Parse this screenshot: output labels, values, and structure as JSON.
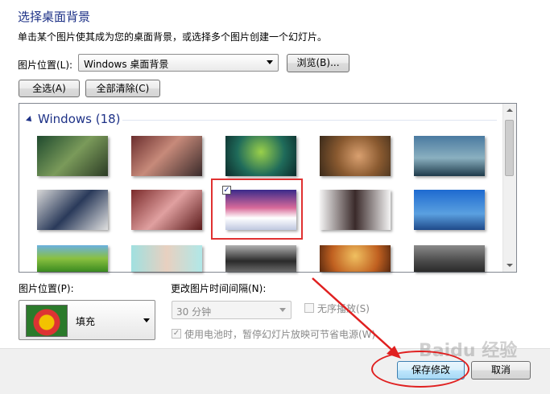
{
  "header": {
    "title": "选择桌面背景",
    "subtitle": "单击某个图片使其成为您的桌面背景，或选择多个图片创建一个幻灯片。"
  },
  "location": {
    "label": "图片位置(L):",
    "value": "Windows 桌面背景",
    "browse_label": "浏览(B)..."
  },
  "selection": {
    "select_all_label": "全选(A)",
    "clear_all_label": "全部清除(C)"
  },
  "gallery": {
    "group_title": "Windows (18)",
    "selected_index": 7
  },
  "position": {
    "label": "图片位置(P):",
    "value": "填充"
  },
  "interval": {
    "label": "更改图片时间间隔(N):",
    "value": "30 分钟",
    "shuffle_label": "无序播放(S)",
    "battery_label": "使用电池时，暂停幻灯片放映可节省电源(W)"
  },
  "footer": {
    "save_label": "保存修改",
    "cancel_label": "取消"
  },
  "watermark": "Baidu 经验"
}
